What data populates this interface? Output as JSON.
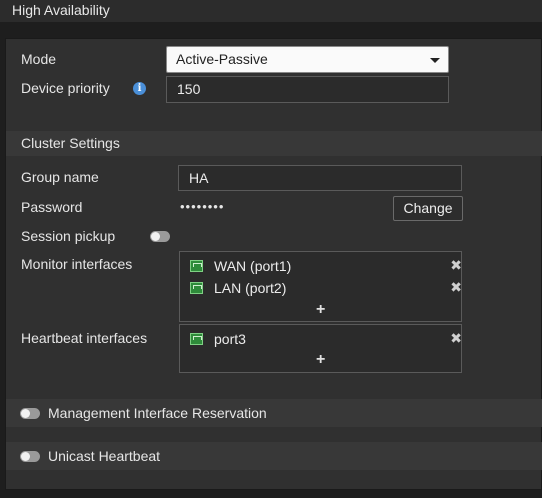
{
  "header": {
    "title": "High Availability"
  },
  "form": {
    "mode_label": "Mode",
    "mode_value": "Active-Passive",
    "priority_label": "Device priority",
    "priority_value": "150",
    "info_glyph": "i"
  },
  "cluster": {
    "section_title": "Cluster Settings",
    "group_name_label": "Group name",
    "group_name_value": "HA",
    "password_label": "Password",
    "password_value": "••••••••",
    "change_button": "Change",
    "session_pickup_label": "Session pickup",
    "session_pickup_enabled": false,
    "monitor_label": "Monitor interfaces",
    "monitor_interfaces": [
      "WAN (port1)",
      "LAN (port2)"
    ],
    "heartbeat_label": "Heartbeat interfaces",
    "heartbeat_interfaces": [
      "port3"
    ],
    "remove_glyph": "✖",
    "add_glyph": "+"
  },
  "toggles": {
    "mgmt_reservation_label": "Management Interface Reservation",
    "mgmt_reservation_enabled": false,
    "unicast_heartbeat_label": "Unicast Heartbeat",
    "unicast_heartbeat_enabled": false
  },
  "colors": {
    "background": "#1e1e1e",
    "panel": "#303030",
    "section": "#383838",
    "port_icon": "#2e8b3a",
    "info_icon": "#4a8fd8"
  }
}
